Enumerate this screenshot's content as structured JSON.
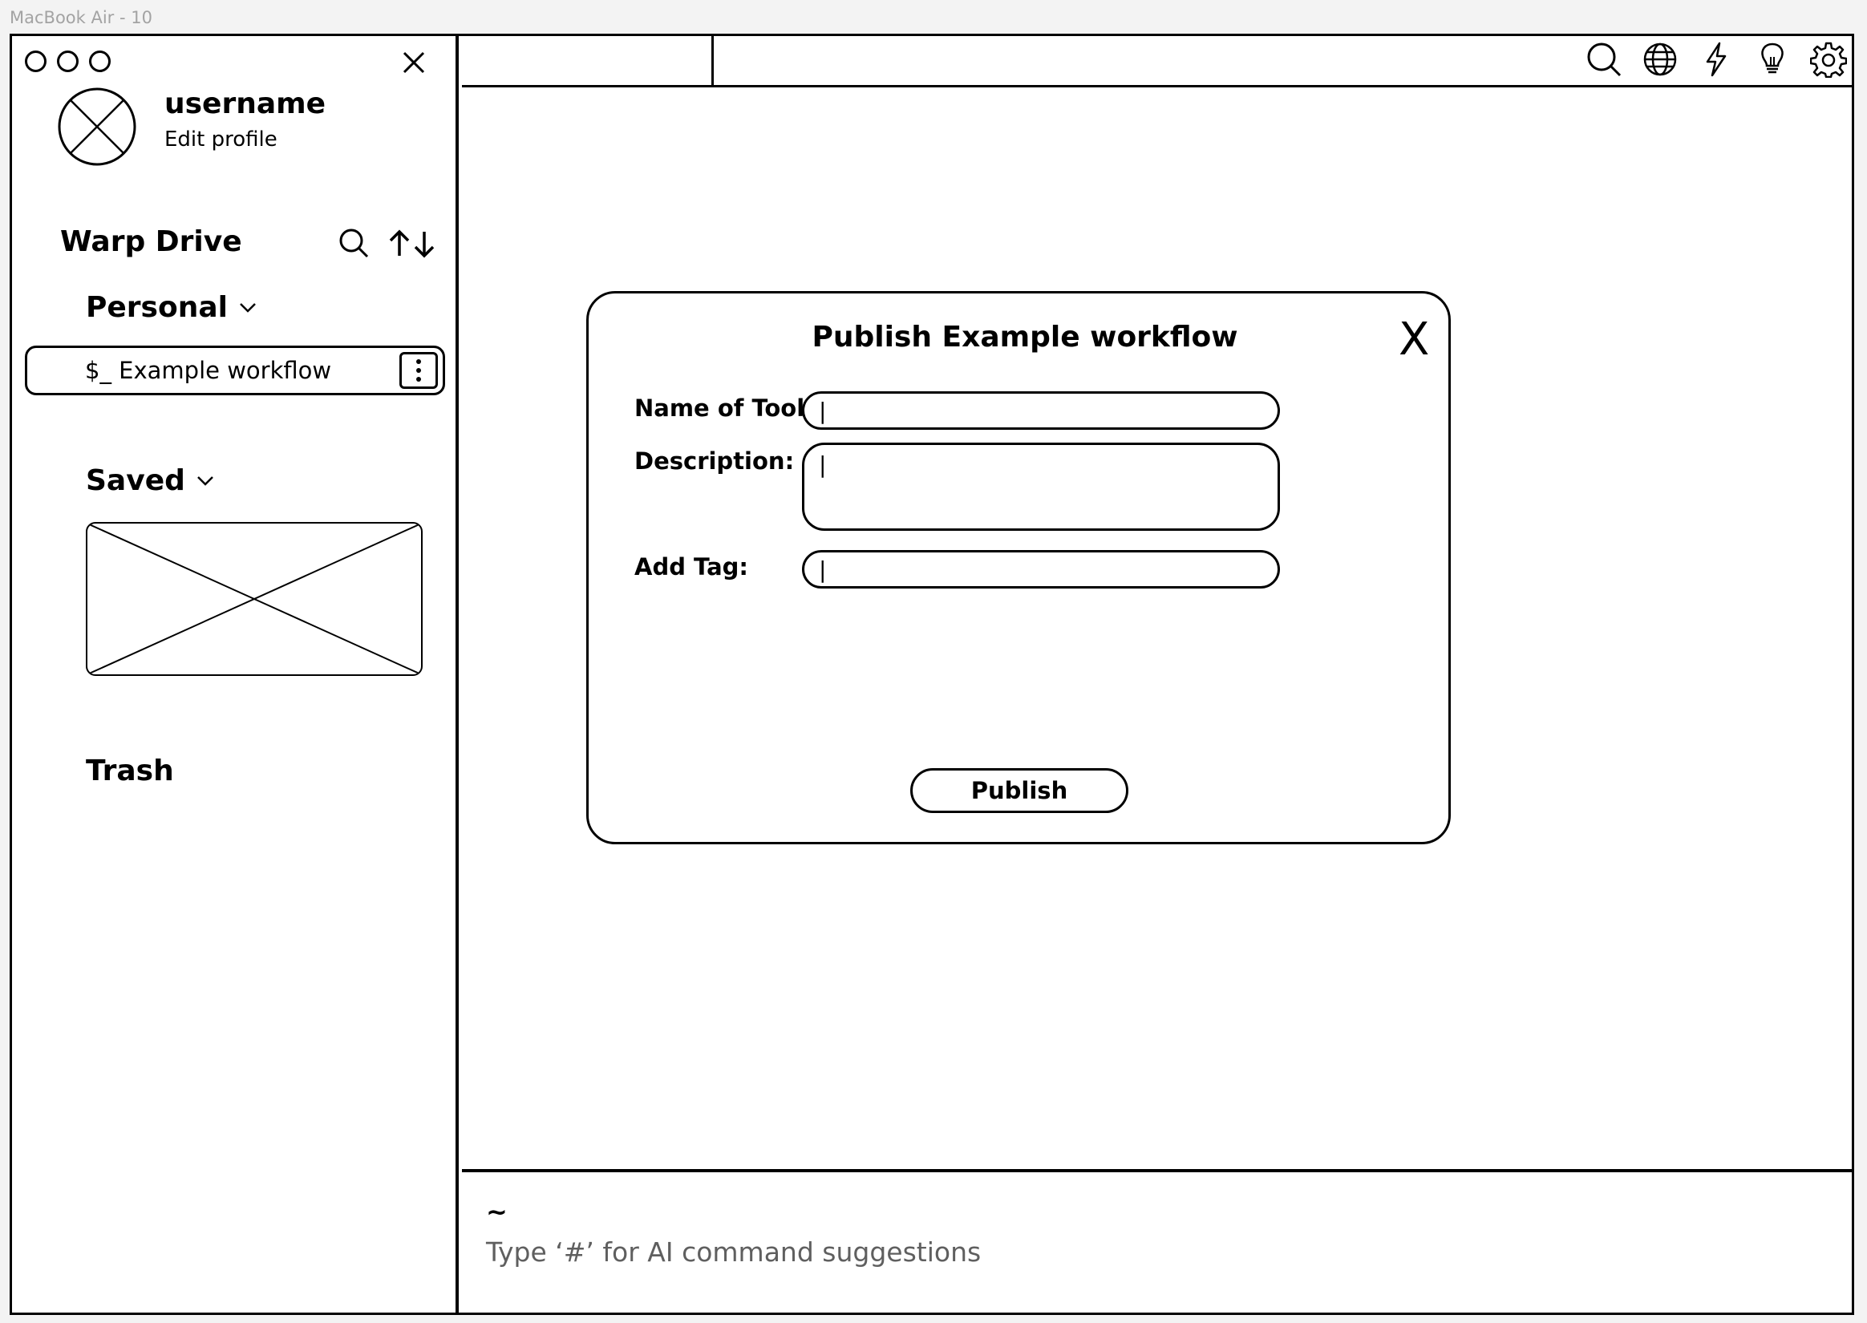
{
  "frame_label": "MacBook Air - 10",
  "sidebar": {
    "username": "username",
    "edit_profile": "Edit profile",
    "section_title": "Warp Drive",
    "personal_label": "Personal",
    "workflow_item": "$_ Example workflow",
    "saved_label": "Saved",
    "trash_label": "Trash"
  },
  "toolbar": {
    "icons": [
      "search-icon",
      "globe-icon",
      "lightning-icon",
      "lightbulb-icon",
      "gear-icon"
    ]
  },
  "dialog": {
    "title": "Publish Example workflow",
    "close_label": "X",
    "name_label": "Name of Tool:",
    "name_value": "|",
    "description_label": "Description:",
    "description_value": "|",
    "tag_label": "Add Tag:",
    "tag_value": "|",
    "publish_label": "Publish"
  },
  "terminal": {
    "prompt_symbol": "~",
    "hint": "Type ‘#’ for AI command suggestions"
  }
}
